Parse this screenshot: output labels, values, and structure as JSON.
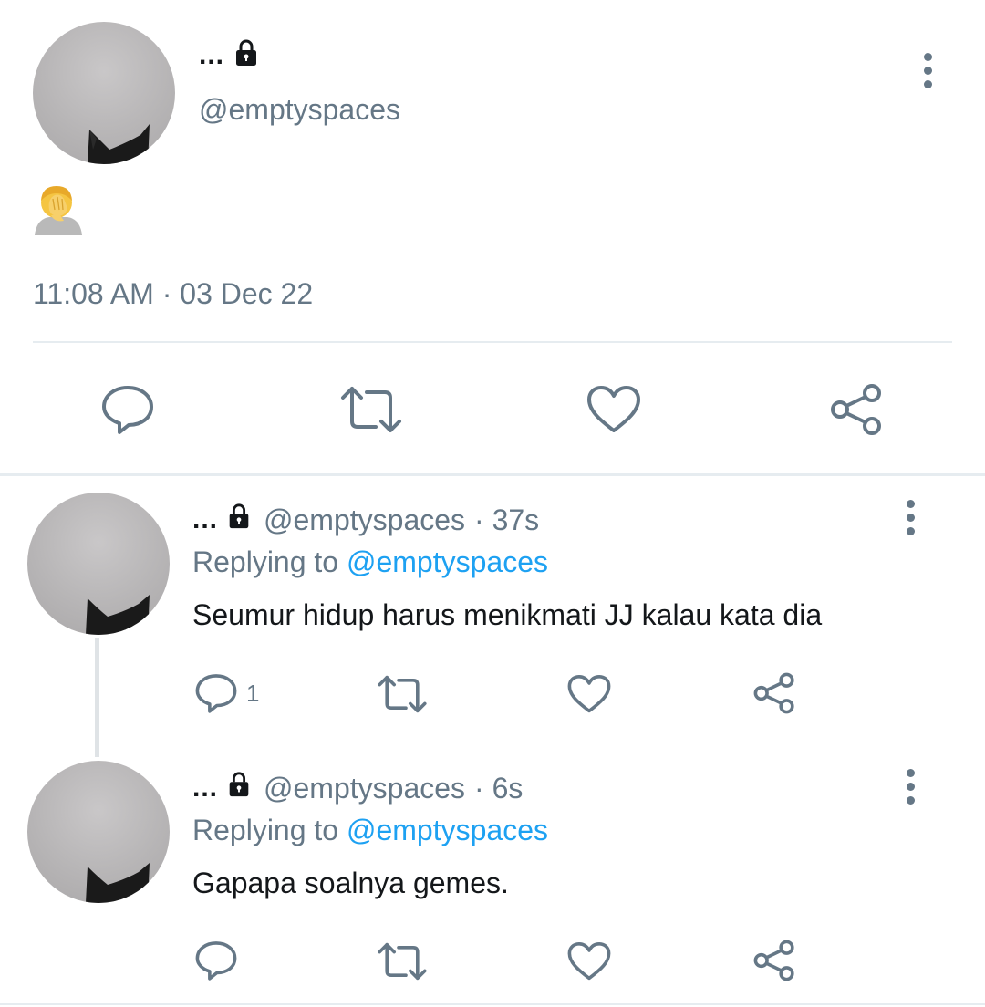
{
  "main_tweet": {
    "display_name": "...",
    "handle": "@emptyspaces",
    "content_emoji": "face-palm-emoji",
    "timestamp": "11:08 AM · 03 Dec 22",
    "icons": {
      "reply": "reply-icon",
      "retweet": "retweet-icon",
      "like": "heart-icon",
      "share": "share-icon",
      "more": "more-vertical-icon",
      "lock": "lock-icon"
    }
  },
  "replies": [
    {
      "display_name": "...",
      "handle": "@emptyspaces",
      "time": "· 37s",
      "replying_prefix": "Replying to",
      "replying_to": "@emptyspaces",
      "text": "Seumur hidup harus menikmati JJ kalau kata dia",
      "reply_count": "1"
    },
    {
      "display_name": "...",
      "handle": "@emptyspaces",
      "time": "· 6s",
      "replying_prefix": "Replying to",
      "replying_to": "@emptyspaces",
      "text": "Gapapa soalnya gemes.",
      "reply_count": ""
    }
  ],
  "colors": {
    "text_primary": "#14171a",
    "text_secondary": "#657786",
    "mention": "#1da1f2",
    "divider": "#e6ecf0"
  }
}
